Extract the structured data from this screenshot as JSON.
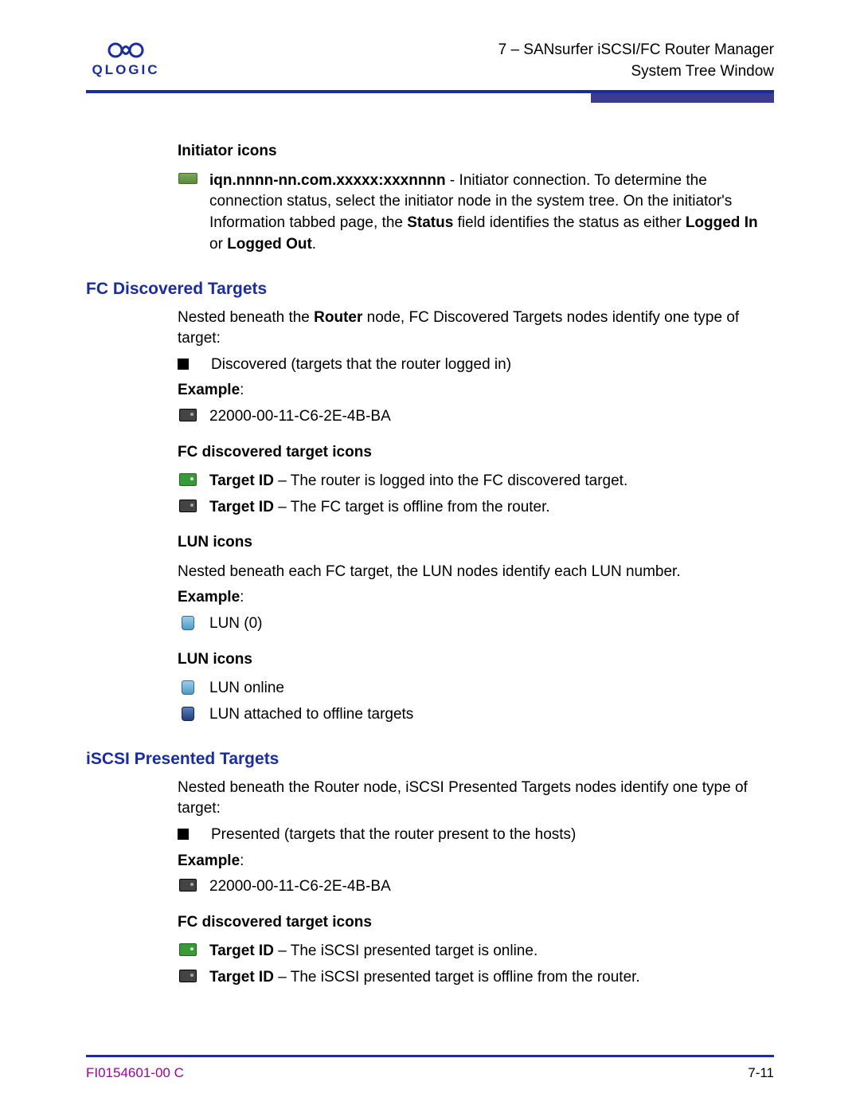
{
  "header": {
    "logo_text": "QLOGIC",
    "line1": "7 – SANsurfer iSCSI/FC Router Manager",
    "line2": "System Tree Window"
  },
  "initiator": {
    "heading": "Initiator icons",
    "bold": "iqn.nnnn-nn.com.xxxxx:xxxnnnn",
    "rest1": " - Initiator connection. To determine the connection status, select the initiator node in the system tree. On the initiator's Information tabbed page, the ",
    "bold2": "Sta­tus",
    "rest2": " field identifies the status as either ",
    "bold3": "Logged In",
    "rest3": " or ",
    "bold4": "Logged Out",
    "rest4": "."
  },
  "fc": {
    "heading": "FC Discovered Targets",
    "intro1": "Nested beneath the ",
    "intro_bold": "Router",
    "intro2": " node, FC Discovered Targets nodes identify one type of target:",
    "bullet": "Discovered (targets that the router logged in)",
    "example_label": "Example",
    "example_value": "22000-00-11-C6-2E-4B-BA",
    "icons_heading": "FC discovered target icons",
    "t1_label": "Target ID",
    "t1_rest": " – The router is logged into the FC discovered target.",
    "t2_label": "Target ID",
    "t2_rest": " – The FC target is offline from the router.",
    "lun_heading1": "LUN icons",
    "lun_intro": "Nested beneath each FC target, the LUN nodes identify each LUN number.",
    "lun_example_label": "Example",
    "lun_example_value": "LUN (0)",
    "lun_heading2": "LUN icons",
    "lun_online": "LUN online",
    "lun_offline": "LUN attached to offline targets"
  },
  "iscsi": {
    "heading": "iSCSI Presented Targets",
    "intro": "Nested beneath the Router node, iSCSI Presented Targets nodes identify one type of target:",
    "bullet": "Presented (targets that the router present to the hosts)",
    "example_label": "Example",
    "example_value": "22000-00-11-C6-2E-4B-BA",
    "icons_heading": "FC discovered target icons",
    "t1_label": "Target ID",
    "t1_rest": " – The iSCSI presented target is online.",
    "t2_label": "Target ID",
    "t2_rest": " – The iSCSI presented target is offline from the router."
  },
  "footer": {
    "left": "FI0154601-00  C",
    "right": "7-11"
  }
}
